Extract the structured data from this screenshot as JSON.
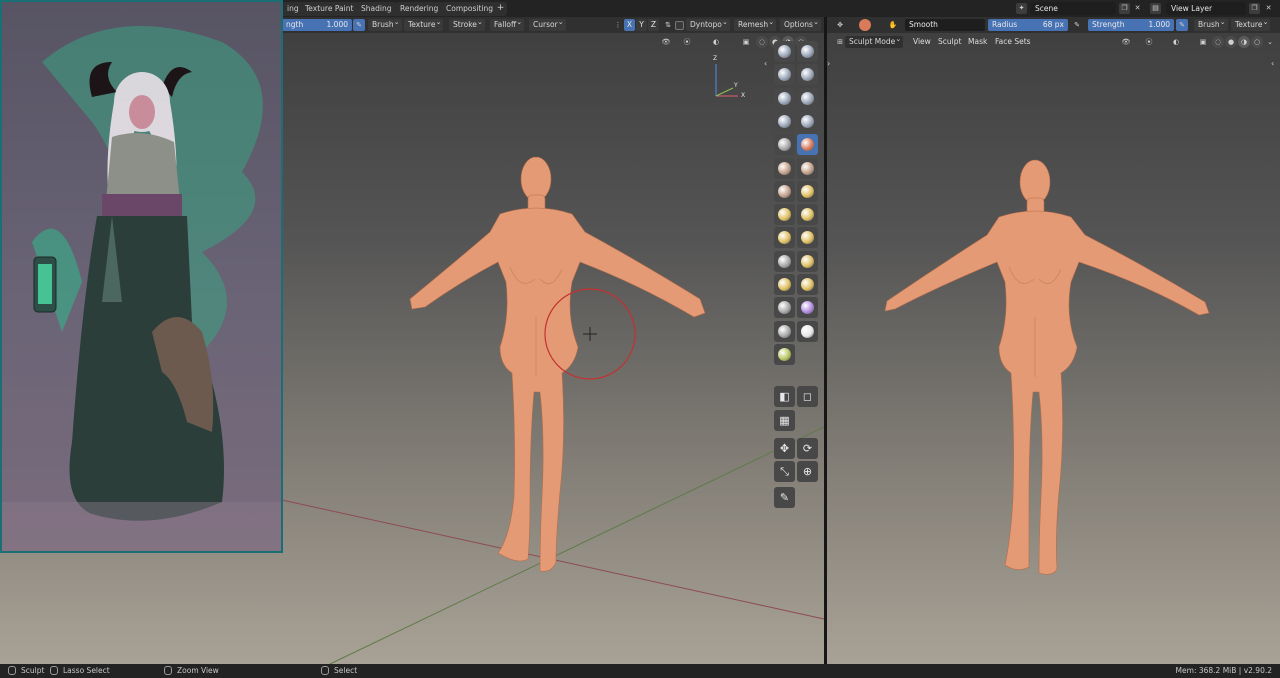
{
  "workspace_tabs": [
    "ing",
    "Texture Paint",
    "Shading",
    "Rendering",
    "Compositing"
  ],
  "add_workspace": "+",
  "scene": {
    "label": "Scene"
  },
  "view_layer": {
    "label": "View Layer"
  },
  "left_header": {
    "strength_label": "ngth",
    "strength_value": "1.000",
    "dropdowns": {
      "brush": "Brush",
      "texture": "Texture",
      "stroke": "Stroke",
      "falloff": "Falloff",
      "cursor": "Cursor"
    },
    "axes": [
      "X",
      "Y",
      "Z"
    ],
    "dyntopo": "Dyntopo",
    "remesh": "Remesh",
    "options": "Options"
  },
  "right_header": {
    "brush_name": "Smooth",
    "radius_label": "Radius",
    "radius_value": "68 px",
    "strength_label": "Strength",
    "strength_value": "1.000",
    "brush_dropdown": "Brush",
    "texture_dropdown": "Texture",
    "mode": "Sculpt Mode",
    "menus": {
      "view": "View",
      "sculpt": "Sculpt",
      "mask": "Mask",
      "face_sets": "Face Sets"
    }
  },
  "gizmo": {
    "x": "X",
    "y": "Y",
    "z": "Z"
  },
  "status_bar": {
    "sculpt": "Sculpt",
    "lasso": "Lasso Select",
    "zoom": "Zoom View",
    "select": "Select",
    "memory": "Mem: 368.2 MiB | v2.90.2"
  },
  "colors": {
    "accent": "#4772b3",
    "skin": "#e49a74",
    "brush_cursor": "#c43030",
    "reference_border": "#1a6f75"
  },
  "tools": [
    {
      "name": "draw",
      "color": "#9aa6b8"
    },
    {
      "name": "draw-sharp",
      "color": "#9aa6b8"
    },
    {
      "name": "clay",
      "color": "#9aa6b8"
    },
    {
      "name": "clay-strips",
      "color": "#9aa6b8"
    },
    {
      "name": "clay-thumb",
      "color": "#9aa6b8"
    },
    {
      "name": "layer",
      "color": "#9aa6b8"
    },
    {
      "name": "inflate",
      "color": "#9aa6b8"
    },
    {
      "name": "blob",
      "color": "#9aa6b8"
    },
    {
      "name": "crease",
      "color": "#a8a8a8"
    },
    {
      "name": "smooth",
      "color": "#d97a5a",
      "active": true
    },
    {
      "name": "flatten",
      "color": "#c4a08a"
    },
    {
      "name": "fill",
      "color": "#c4a08a"
    },
    {
      "name": "scrape",
      "color": "#c4a08a"
    },
    {
      "name": "multiplane-scrape",
      "color": "#e0c060"
    },
    {
      "name": "pinch",
      "color": "#e0c060"
    },
    {
      "name": "grab",
      "color": "#e0c060"
    },
    {
      "name": "elastic-deform",
      "color": "#e0c060"
    },
    {
      "name": "snake-hook",
      "color": "#e0c060"
    },
    {
      "name": "thumb",
      "color": "#a8a8a8"
    },
    {
      "name": "pose",
      "color": "#e0c060"
    },
    {
      "name": "nudge",
      "color": "#e0c060"
    },
    {
      "name": "rotate",
      "color": "#e0c060"
    },
    {
      "name": "slide-relax",
      "color": "#a8a8a8"
    },
    {
      "name": "boundary",
      "color": "#b28be0"
    },
    {
      "name": "cloth",
      "color": "#a8a8a8"
    },
    {
      "name": "simplify",
      "color": "#e8e8e8"
    },
    {
      "name": "mask",
      "color": "#b8c860"
    }
  ]
}
